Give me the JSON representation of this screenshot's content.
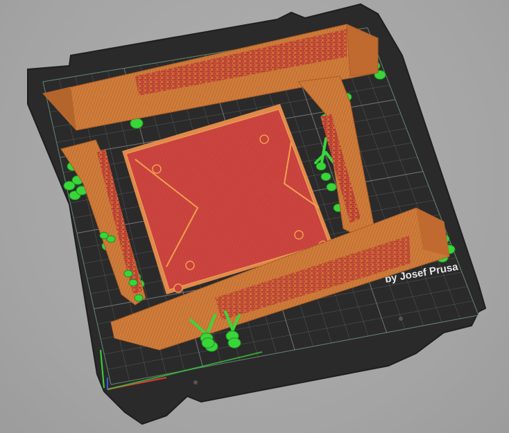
{
  "viewport": {
    "background": "#a7a7a7",
    "bed_logo_text": "by Josef Prusa",
    "colors": {
      "bed": "#2b2b2b",
      "grid": "#8a8a8a",
      "perimeter": "#cf7a3a",
      "infill": "#c8413c",
      "support": "#39d63a",
      "axis_x": "#e23a3a",
      "axis_y": "#3ad63a",
      "axis_z": "#3a5ae2"
    },
    "icons": {
      "bed": "print-bed-icon",
      "axes": "axes-gizmo-icon"
    }
  }
}
